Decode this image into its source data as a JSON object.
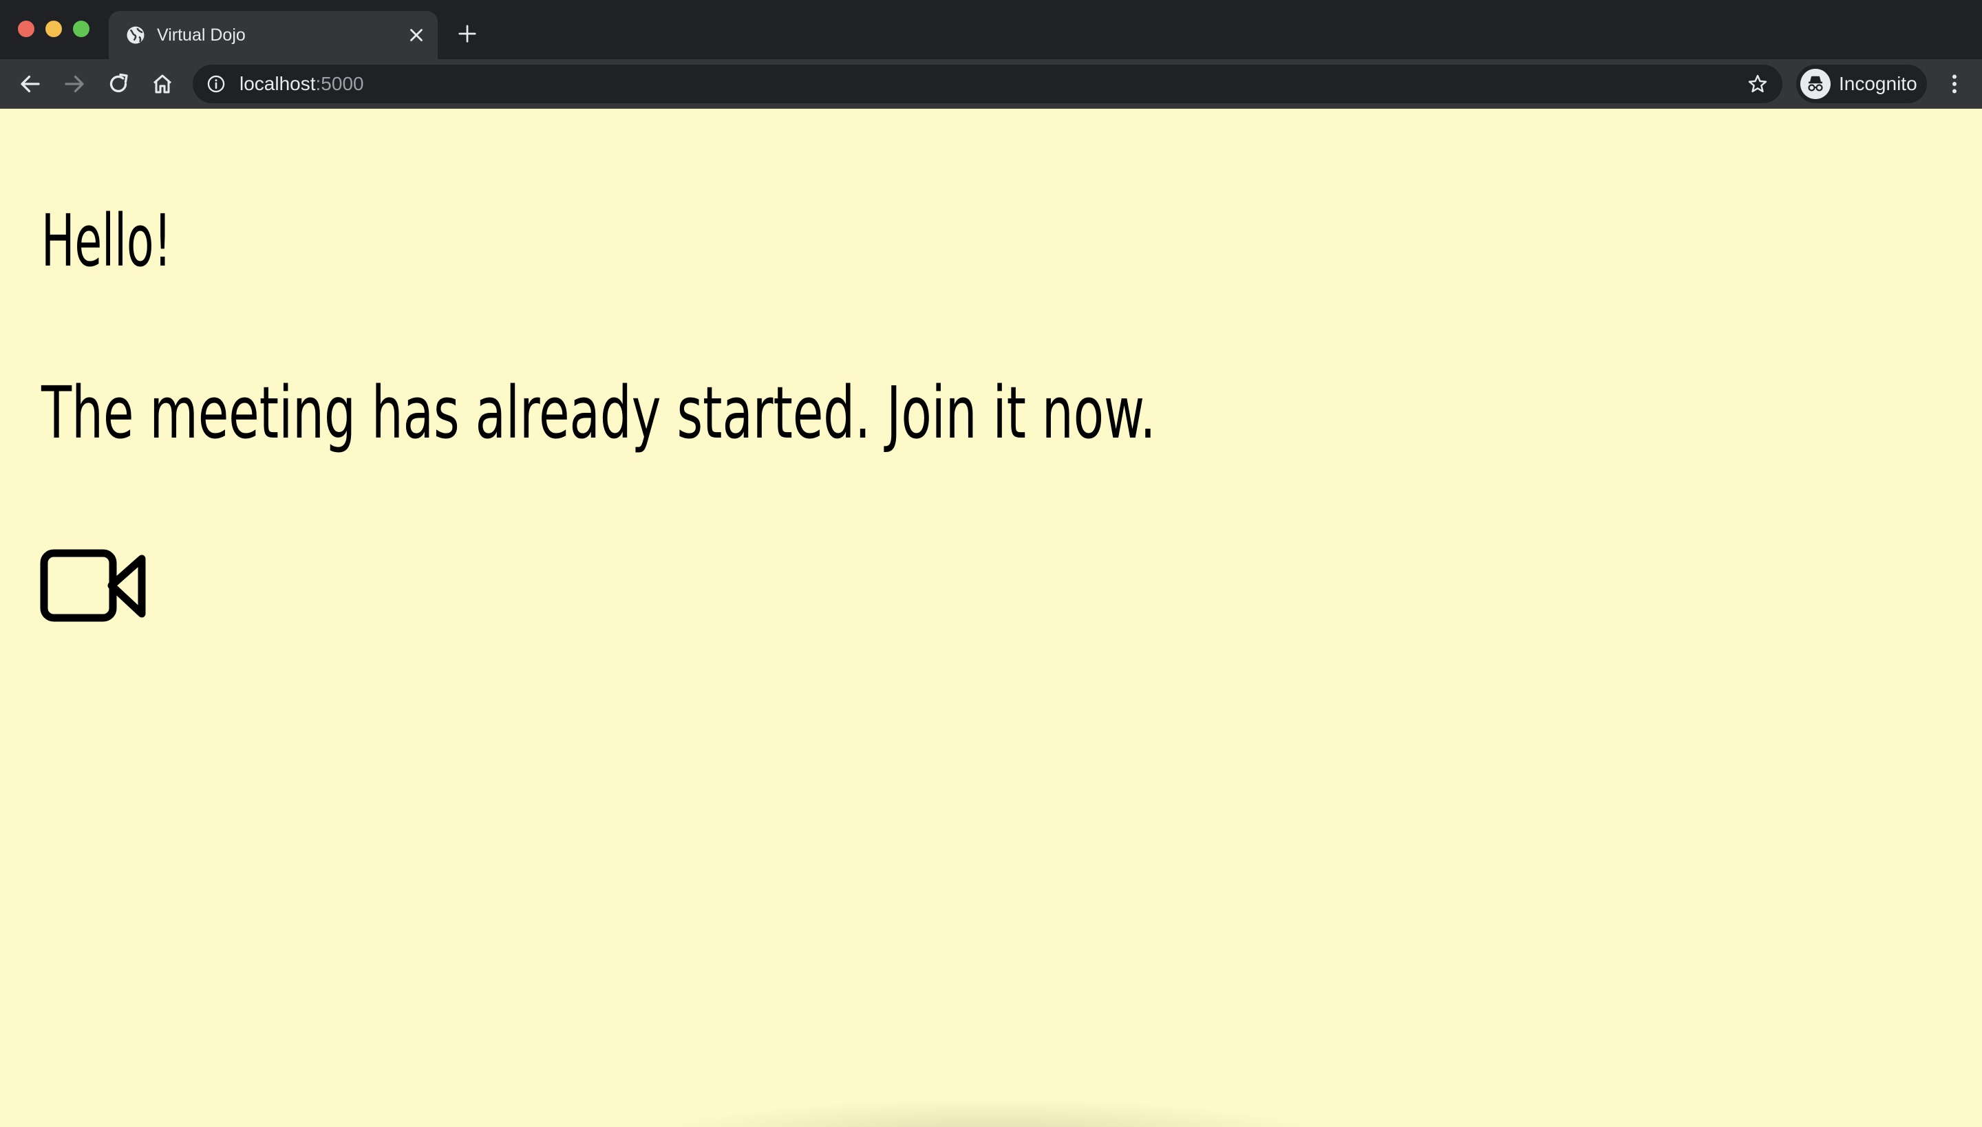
{
  "browser": {
    "tab": {
      "title": "Virtual Dojo",
      "icon": "globe-icon"
    },
    "address_bar": {
      "host": "localhost",
      "port": ":5000"
    },
    "profile": {
      "label": "Incognito",
      "icon": "incognito-icon"
    }
  },
  "page": {
    "background": "#fef9c8",
    "greeting": "Hello!",
    "message": "The meeting has already started. Join it now.",
    "join_icon": "video-camera-icon"
  }
}
